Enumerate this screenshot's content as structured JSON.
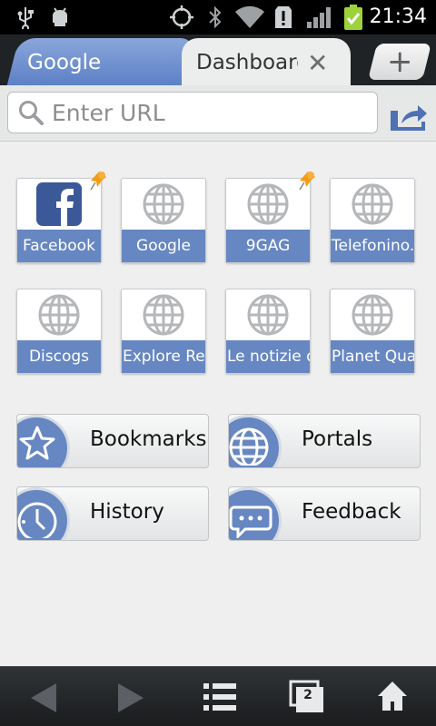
{
  "status_bar": {
    "time": "21:34",
    "icons": [
      "usb-icon",
      "android-debug-icon",
      "gps-icon",
      "bluetooth-icon",
      "wifi-icon",
      "alert-icon",
      "signal-icon",
      "battery-icon"
    ]
  },
  "tabs": [
    {
      "label": "Google",
      "active": false
    },
    {
      "label": "Dashboard",
      "active": true
    }
  ],
  "url_bar": {
    "placeholder": "Enter URL"
  },
  "speed_dial": [
    {
      "label": "Facebook",
      "icon": "facebook-icon",
      "pinned": true
    },
    {
      "label": "Google",
      "icon": "globe-icon",
      "pinned": false
    },
    {
      "label": "9GAG",
      "icon": "globe-icon",
      "pinned": true
    },
    {
      "label": "Telefonino.",
      "icon": "globe-icon",
      "pinned": false
    },
    {
      "label": "Discogs",
      "icon": "globe-icon",
      "pinned": false
    },
    {
      "label": "Explore Rel",
      "icon": "globe-icon",
      "pinned": false
    },
    {
      "label": "Le notizie d",
      "icon": "globe-icon",
      "pinned": false
    },
    {
      "label": "Planet Qua",
      "icon": "globe-icon",
      "pinned": false
    }
  ],
  "shortcuts": [
    {
      "label": "Bookmarks",
      "icon": "star-icon"
    },
    {
      "label": "Portals",
      "icon": "globe-icon"
    },
    {
      "label": "History",
      "icon": "clock-icon"
    },
    {
      "label": "Feedback",
      "icon": "speech-bubble-icon"
    }
  ],
  "bottom_bar": {
    "tab_count": "2"
  },
  "colors": {
    "accent": "#6787c2",
    "tab_inactive": "#5b7fc6"
  }
}
